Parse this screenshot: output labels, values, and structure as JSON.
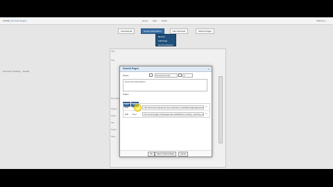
{
  "app": {
    "logo": "ANNEE",
    "logo_sub": "Life Technologies",
    "center_links": [
      "Home",
      "Help",
      "Admin"
    ],
    "user_info": "Welcome ..."
  },
  "tabs": [
    "Instructional",
    "Accept Submission",
    "File Overview",
    "Submit Pages"
  ],
  "dropdown": {
    "items": [
      "Review",
      "Add Page",
      "Set Permissions"
    ]
  },
  "left_labels": [
    "Document Tracking",
    "Details"
  ],
  "side_labels": [
    "Title",
    "Sub",
    "Description",
    "Pages",
    "Page",
    "File",
    "Notes",
    "Tags"
  ],
  "dialog": {
    "title": "Submit Pages",
    "close": "×",
    "row1": {
      "label": "Select",
      "select1": "Document Code",
      "select2": "A"
    },
    "description": "Document Description",
    "pages_label": "Pages",
    "buttons": [
      "Add",
      "Delete"
    ],
    "table_rows": [
      {
        "col1": "Edit",
        "col2": "Pg 1",
        "text": "This document references the conversion of standard legal agreements to plain",
        "action": "✎"
      },
      {
        "col1": "Edit",
        "col2": "Pg 2",
        "text": "The second page of language was established in testing, reporting, and other",
        "action": "✎"
      }
    ],
    "footer_buttons": [
      "OK",
      "Save & Submit Pages",
      "Cancel"
    ]
  },
  "colors": {
    "accent": "#3a6ea5",
    "dialog_title_bg": "#dfe9f4"
  }
}
